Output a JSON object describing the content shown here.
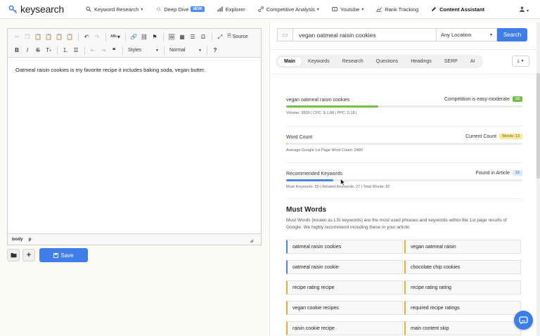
{
  "nav": {
    "logo": "keysearch",
    "items": [
      {
        "label": "Keyword Research",
        "icon": "search-icon",
        "caret": true
      },
      {
        "label": "Deep Dive",
        "icon": "diamond-icon",
        "badge": "NEW!"
      },
      {
        "label": "Explorer",
        "icon": "chart-icon"
      },
      {
        "label": "Competitive Analysis",
        "icon": "link-icon",
        "caret": true
      },
      {
        "label": "Youtube",
        "icon": "video-icon",
        "caret": true
      },
      {
        "label": "Rank Tracking",
        "icon": "line-chart-icon"
      },
      {
        "label": "Content Assistant",
        "icon": "pen-icon",
        "active": true
      }
    ]
  },
  "editor": {
    "content": "Oatmeal raisin cookies is my favorite recipe it includes baking soda, vegan butter,",
    "source_label": "Source",
    "styles_label": "Styles",
    "format_label": "Normal",
    "path": [
      "body",
      "p"
    ]
  },
  "actions": {
    "save_label": "Save"
  },
  "search": {
    "keyword": "vegan oatmeal raisin cookies",
    "location": "Any Location",
    "button": "Search"
  },
  "tabs": [
    "Main",
    "Keywords",
    "Research",
    "Questions",
    "Headings",
    "SERP",
    "AI"
  ],
  "active_tab": "Main",
  "metrics": {
    "keyword": {
      "label": "vegan oatmeal raisin cookies",
      "right_label": "Competition is easy-moderate",
      "score": "39",
      "progress": 0.39,
      "sub": "Volume: 3600 | CPC: $ 1.88 | PPC: 0.18 |"
    },
    "word_count": {
      "label": "Word Count",
      "right_label": "Current Count",
      "badge": "Words: 13",
      "progress": 0.005,
      "sub": "Average Google 1st Page Word Count: 2480"
    },
    "recommended": {
      "label": "Recommended Keywords",
      "right_label": "Found in Article",
      "badge": "16",
      "progress": 0.2,
      "sub": "Must Keywords: 55 | Related Keywords: 27 | Total Words: 82"
    }
  },
  "must_words": {
    "title": "Must Words",
    "description": "Must Words (known as LSI keywords) are the most used phrases and keywords within the 1st page results of Google. We highly recommend including these in your article.",
    "items": [
      {
        "text": "oatmeal raisin cookies",
        "accent": "blue"
      },
      {
        "text": "vegan oatmeal raisin",
        "accent": "orange"
      },
      {
        "text": "oatmeal raisin cookie",
        "accent": "blue"
      },
      {
        "text": "chocolate chip cookies",
        "accent": "orange"
      },
      {
        "text": "recipe rating recipe",
        "accent": "orange"
      },
      {
        "text": "recipe rating rating",
        "accent": "orange"
      },
      {
        "text": "vegan cookie recipes",
        "accent": "orange"
      },
      {
        "text": "required recipe ratings",
        "accent": "orange"
      },
      {
        "text": "raisin cookie recipe",
        "accent": "orange"
      },
      {
        "text": "main content skip",
        "accent": "orange"
      }
    ]
  },
  "colors": {
    "accent": "#3f7ee8",
    "green": "#74c04a",
    "orange": "#f2a93b"
  }
}
